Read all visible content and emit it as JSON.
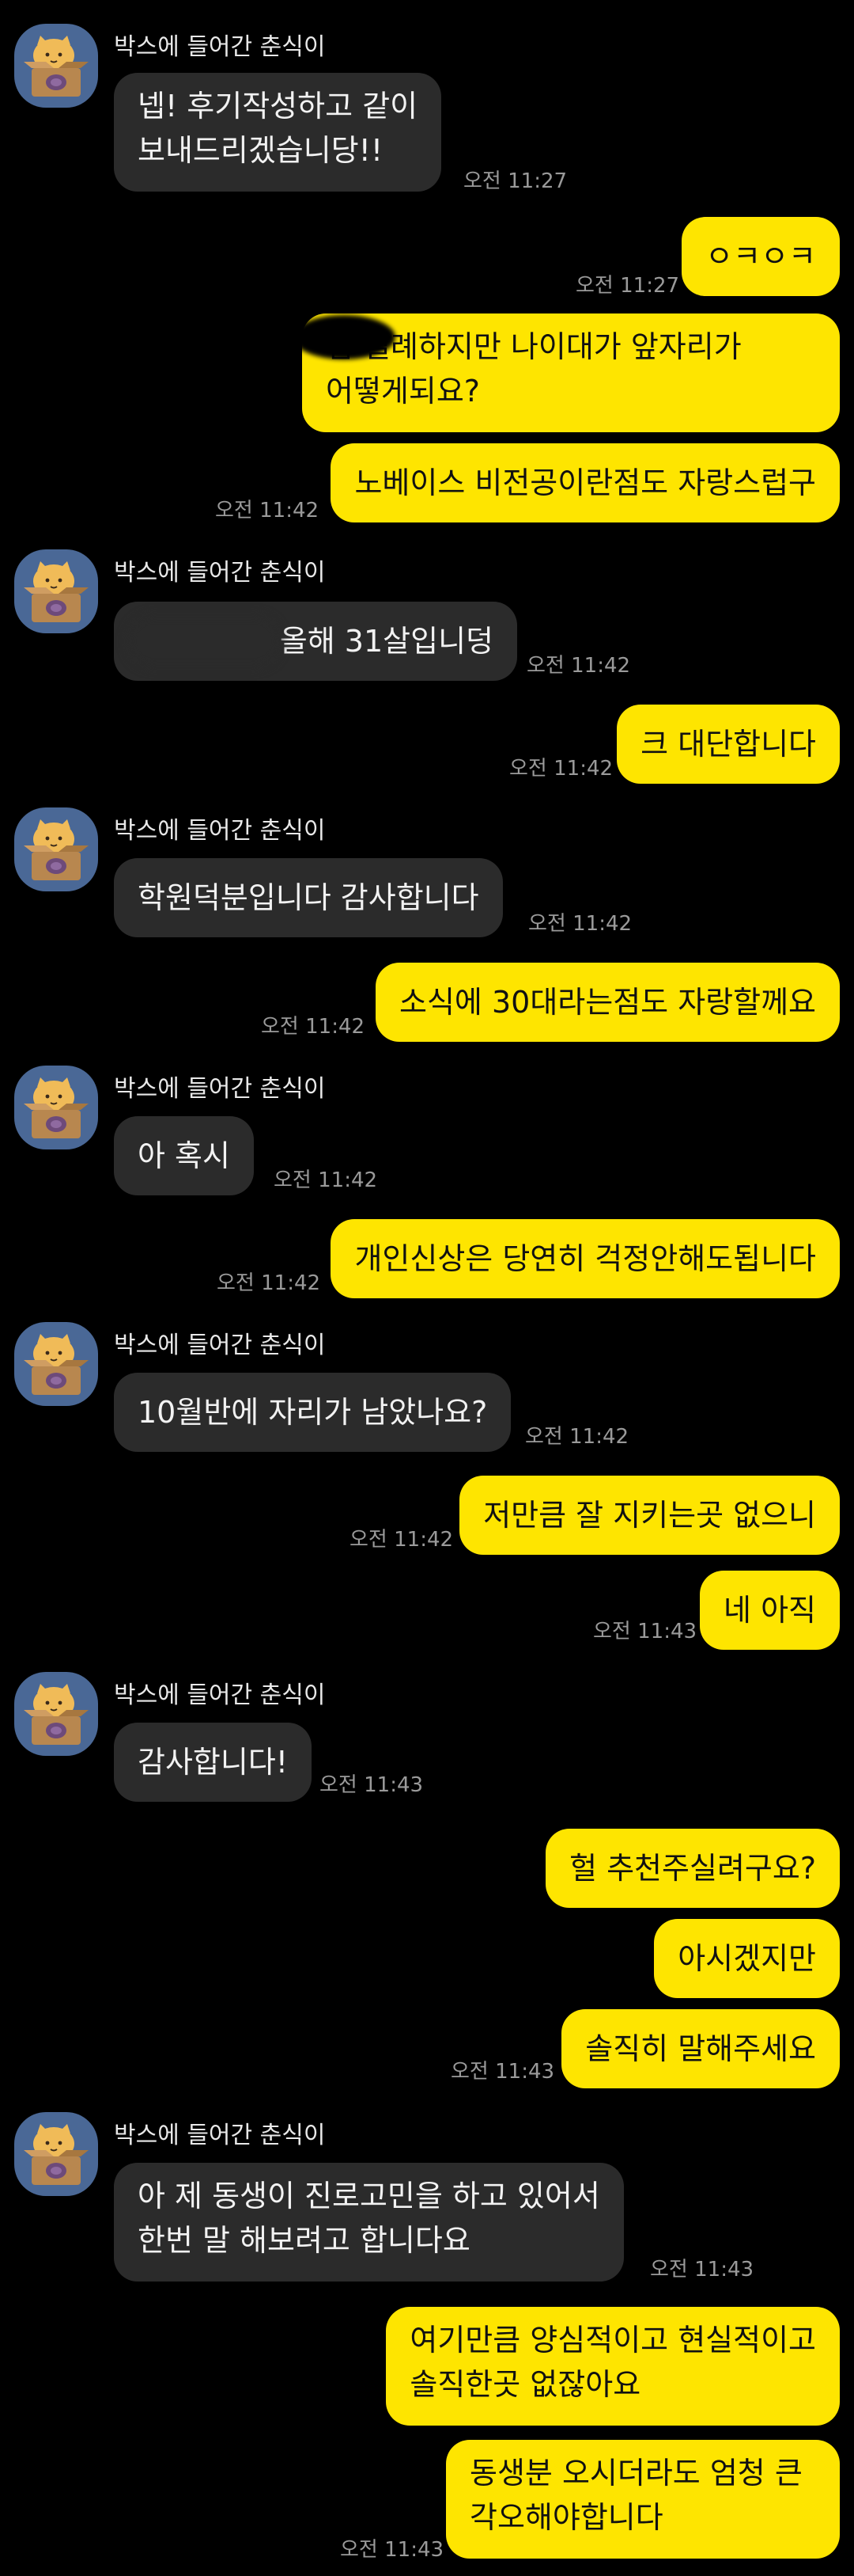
{
  "sender_name": "박스에 들어간 춘식이",
  "messages": {
    "m1": {
      "lines": [
        "넵! 후기작성하고 같이",
        "보내드리겠습니당!!"
      ],
      "time": "오전 11:27"
    },
    "m2": {
      "text": "ㅇㅋㅇㅋ",
      "time": "오전 11:27"
    },
    "m3": {
      "lines": [
        "님 실례하지만 나이대가 앞자리가",
        "어떻게되요?"
      ]
    },
    "m4": {
      "text": "노베이스 비전공이란점도 자랑스럽구",
      "time": "오전 11:42"
    },
    "m5": {
      "text": "올해 31살입니덩",
      "time": "오전 11:42"
    },
    "m6": {
      "text": "크 대단합니다",
      "time": "오전 11:42"
    },
    "m7": {
      "text": "학원덕분입니다 감사합니다",
      "time": "오전 11:42"
    },
    "m8": {
      "text": "소식에 30대라는점도 자랑할께요",
      "time": "오전 11:42"
    },
    "m9": {
      "text": "아 혹시",
      "time": "오전 11:42"
    },
    "m10": {
      "text": "개인신상은 당연히 걱정안해도됩니다",
      "time": "오전 11:42"
    },
    "m11": {
      "text": "10월반에 자리가 남았나요?",
      "time": "오전 11:42"
    },
    "m12": {
      "text": "저만큼 잘 지키는곳 없으니",
      "time": "오전 11:42"
    },
    "m13": {
      "text": "네 아직",
      "time": "오전 11:43"
    },
    "m14": {
      "text": "감사합니다!",
      "time": "오전 11:43"
    },
    "m15": {
      "text": "헐 추천주실려구요?"
    },
    "m16": {
      "text": "아시겠지만"
    },
    "m17": {
      "text": "솔직히 말해주세요",
      "time": "오전 11:43"
    },
    "m18": {
      "lines": [
        "아 제 동생이 진로고민을 하고 있어서",
        "한번 말 해보려고 합니다요"
      ],
      "time": "오전 11:43"
    },
    "m19": {
      "lines": [
        "여기만큼 양심적이고 현실적이고",
        "솔직한곳 없잖아요"
      ]
    },
    "m20": {
      "lines": [
        "동생분 오시더라도 엄청 큰",
        "각오해야합니다"
      ],
      "time": "오전 11:43"
    }
  },
  "colors": {
    "background": "#000000",
    "incoming_bubble": "#2b2b2b",
    "outgoing_bubble": "#fee500",
    "sender_text": "#e8e8e8",
    "time_text": "#9a9a9a",
    "avatar_bg": "#4a6896"
  },
  "avatar_icon": "chunsik-in-box-character"
}
